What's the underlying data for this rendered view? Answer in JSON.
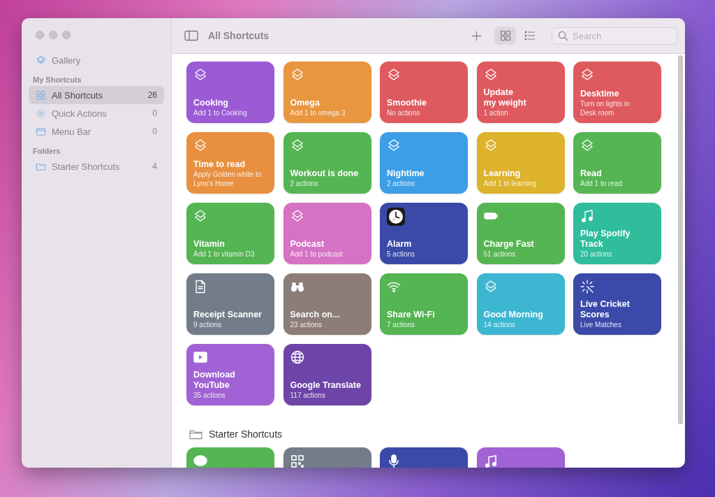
{
  "window": {
    "title": "All Shortcuts"
  },
  "sidebar": {
    "top_items": [
      {
        "label": "Gallery",
        "kind": "layers",
        "selected": false
      }
    ],
    "sections": [
      {
        "heading": "My Shortcuts",
        "items": [
          {
            "label": "All Shortcuts",
            "kind": "grid",
            "count": "26",
            "selected": true
          },
          {
            "label": "Quick Actions",
            "kind": "gear",
            "count": "0",
            "selected": false
          },
          {
            "label": "Menu Bar",
            "kind": "window",
            "count": "0",
            "selected": false
          }
        ]
      },
      {
        "heading": "Folders",
        "items": [
          {
            "label": "Starter Shortcuts",
            "kind": "folder",
            "count": "4",
            "selected": false
          }
        ]
      }
    ]
  },
  "toolbar": {
    "view_buttons": [
      {
        "kind": "grid",
        "selected": true
      },
      {
        "kind": "list",
        "selected": false
      }
    ],
    "search": {
      "placeholder": "Search"
    }
  },
  "shortcuts": [
    {
      "title": "Cooking",
      "subtitle": "Add 1 to Cooking",
      "kind": "layers",
      "color": "#9b5bd4"
    },
    {
      "title": "Omega",
      "subtitle": "Add 1 to omega 3",
      "kind": "layers",
      "color": "#e8963f"
    },
    {
      "title": "Smoothie",
      "subtitle": "No actions",
      "kind": "layers",
      "color": "#de5a5e"
    },
    {
      "title": "Update\nmy weight",
      "subtitle": "1 action",
      "kind": "layers",
      "color": "#de5a5e"
    },
    {
      "title": "Desktime",
      "subtitle": "Turn on lights in\nDesk room",
      "kind": "layers",
      "color": "#de5a5e"
    },
    {
      "title": "Time to read",
      "subtitle": "Apply Golden white to\nLynn's Home",
      "kind": "layers",
      "color": "#e8903f"
    },
    {
      "title": "Workout is done",
      "subtitle": "2 actions",
      "kind": "layers",
      "color": "#55b553"
    },
    {
      "title": "Nightime",
      "subtitle": "2 actions",
      "kind": "layers",
      "color": "#3d9ee8"
    },
    {
      "title": "Learning",
      "subtitle": "Add 1 to learning",
      "kind": "layers",
      "color": "#ddb32c"
    },
    {
      "title": "Read",
      "subtitle": "Add 1 to read",
      "kind": "layers",
      "color": "#55b553"
    },
    {
      "title": "Vitamin",
      "subtitle": "Add 1 to vitamin D3",
      "kind": "layers",
      "color": "#55b553"
    },
    {
      "title": "Podcast",
      "subtitle": "Add 1 to podcast",
      "kind": "layers",
      "color": "#d672c4"
    },
    {
      "title": "Alarm",
      "subtitle": "5 actions",
      "kind": "clock",
      "color": "#3b4aa8"
    },
    {
      "title": "Charge Fast",
      "subtitle": "51 actions",
      "kind": "battery",
      "color": "#55b553"
    },
    {
      "title": "Play Spotify\nTrack",
      "subtitle": "20 actions",
      "kind": "music",
      "color": "#2fbd9c"
    },
    {
      "title": "Receipt Scanner",
      "subtitle": "9 actions",
      "kind": "document",
      "color": "#737d8a"
    },
    {
      "title": "Search on...",
      "subtitle": "23 actions",
      "kind": "binoculars",
      "color": "#8c7d78"
    },
    {
      "title": "Share Wi-Fi",
      "subtitle": "7 actions",
      "kind": "wifi",
      "color": "#55b553"
    },
    {
      "title": "Good Morning",
      "subtitle": "14 actions",
      "kind": "layers",
      "color": "#3db6d2"
    },
    {
      "title": "Live Cricket\nScores",
      "subtitle": "Live Matches",
      "kind": "sparkle",
      "color": "#3b4aa8"
    },
    {
      "title": "Download\nYouTube",
      "subtitle": "35 actions",
      "kind": "play",
      "color": "#a062d4"
    },
    {
      "title": "Google Translate",
      "subtitle": "117 actions",
      "kind": "globe",
      "color": "#6d44a8"
    }
  ],
  "starter_section": {
    "title": "Starter Shortcuts",
    "shortcuts": [
      {
        "kind": "chat",
        "color": "#55b553"
      },
      {
        "kind": "qr",
        "color": "#737d8a"
      },
      {
        "kind": "mic",
        "color": "#3b4aa8"
      },
      {
        "kind": "music",
        "color": "#a062d4"
      }
    ]
  }
}
